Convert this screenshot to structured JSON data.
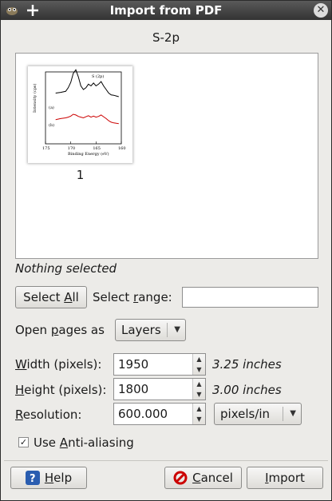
{
  "window": {
    "title": "Import from PDF"
  },
  "file_title": "S-2p",
  "preview": {
    "pages": [
      {
        "number": "1",
        "chart_data": {
          "type": "line",
          "title": "S (2p)",
          "xlabel": "Binding Energy (eV)",
          "ylabel": "Intensity (cps)",
          "x_ticks": [
            "175",
            "170",
            "165",
            "160"
          ],
          "xlim": [
            175,
            160
          ],
          "series": [
            {
              "name": "(a)",
              "color": "#000000",
              "x": [
                173,
                172,
                171,
                170.5,
                170,
                169.5,
                169,
                168.5,
                168,
                167.5,
                167,
                166.5,
                166,
                165.5,
                165,
                164.5,
                164,
                163.5,
                163,
                162.5,
                162,
                161.5,
                161,
                160.5
              ],
              "values": [
                0.3,
                0.32,
                0.35,
                0.45,
                0.6,
                0.85,
                0.95,
                0.75,
                0.5,
                0.4,
                0.45,
                0.55,
                0.5,
                0.58,
                0.5,
                0.55,
                0.62,
                0.5,
                0.4,
                0.3,
                0.25,
                0.24,
                0.22,
                0.2
              ]
            },
            {
              "name": "(b)",
              "color": "#cc0000",
              "x": [
                173,
                172,
                171,
                170.5,
                170,
                169.5,
                169,
                168.5,
                168,
                167.5,
                167,
                166.5,
                166,
                165.5,
                165,
                164.5,
                164,
                163.5,
                163,
                162.5,
                162,
                161.5,
                161,
                160.5
              ],
              "values": [
                0.05,
                0.08,
                0.1,
                0.12,
                0.15,
                0.2,
                0.18,
                0.14,
                0.12,
                0.1,
                0.13,
                0.16,
                0.12,
                0.15,
                0.12,
                0.14,
                0.18,
                0.13,
                0.08,
                0.02,
                -0.02,
                -0.04,
                -0.05,
                -0.06
              ]
            }
          ]
        }
      }
    ]
  },
  "status": "Nothing selected",
  "select_all": {
    "label_pre": "Select ",
    "label_u": "A",
    "label_post": "ll"
  },
  "select_range": {
    "label_pre": "Select ",
    "label_u": "r",
    "label_post": "ange:",
    "value": ""
  },
  "open_pages_as": {
    "label_pre": "Open ",
    "label_u": "p",
    "label_post": "ages as",
    "value": "Layers"
  },
  "width": {
    "label_u": "W",
    "label_post": "idth (pixels):",
    "value": "1950",
    "hint": "3.25 inches"
  },
  "height": {
    "label_u": "H",
    "label_post": "eight (pixels):",
    "value": "1800",
    "hint": "3.00 inches"
  },
  "resolution": {
    "label_u": "R",
    "label_post": "esolution:",
    "value": "600.000",
    "unit": "pixels/in"
  },
  "antialias": {
    "checked": true,
    "label_pre": "Use ",
    "label_u": "A",
    "label_post": "nti-aliasing"
  },
  "buttons": {
    "help": {
      "label_u": "H",
      "label_post": "elp"
    },
    "cancel": {
      "label_u": "C",
      "label_post": "ancel"
    },
    "import": {
      "label_u": "I",
      "label_post": "mport"
    }
  },
  "colors": {
    "titlebar": "#333333",
    "series_a": "#000000",
    "series_b": "#cc0000",
    "help_icon": "#2a5db0",
    "cancel_icon": "#cc0000"
  }
}
